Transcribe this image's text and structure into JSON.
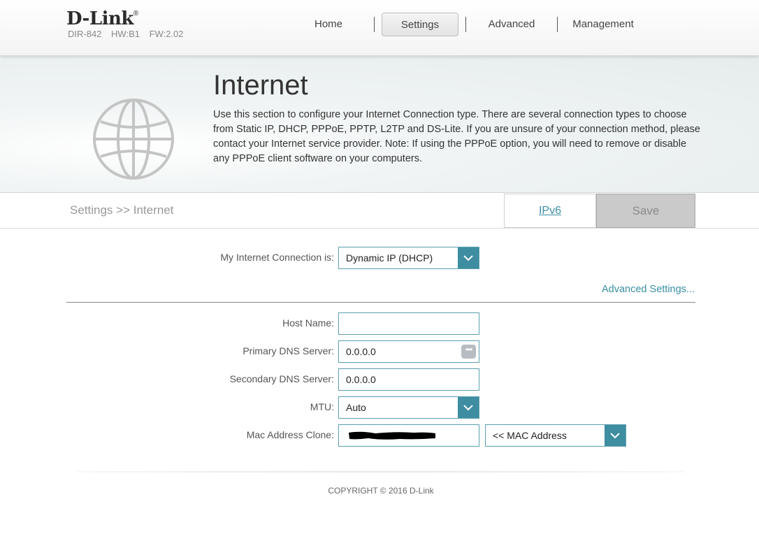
{
  "brand": {
    "logo": "D-Link",
    "reg": "®",
    "model": "DIR-842",
    "hw": "HW:B1",
    "fw": "FW:2.02"
  },
  "nav": {
    "home": "Home",
    "settings": "Settings",
    "advanced": "Advanced",
    "management": "Management",
    "active": "Settings"
  },
  "banner": {
    "title": "Internet",
    "description": "Use this section to configure your Internet Connection type. There are several connection types to choose from Static IP, DHCP, PPPoE, PPTP, L2TP and DS-Lite. If you are unsure of your connection method, please contact your Internet service provider. Note: If using the PPPoE option, you will need to remove or disable any PPPoE client software on your computers."
  },
  "breadcrumb": "Settings >> Internet",
  "toolbar": {
    "ipv6_label": "IPv6",
    "save_label": "Save"
  },
  "form": {
    "connection": {
      "label": "My Internet Connection is:",
      "value": "Dynamic IP (DHCP)"
    },
    "advanced_link": "Advanced Settings...",
    "host_name": {
      "label": "Host Name:",
      "value": ""
    },
    "primary_dns": {
      "label": "Primary DNS Server:",
      "value": "0.0.0.0"
    },
    "secondary_dns": {
      "label": "Secondary DNS Server:",
      "value": "0.0.0.0"
    },
    "mtu": {
      "label": "MTU:",
      "value": "Auto"
    },
    "mac_clone": {
      "label": "Mac Address Clone:",
      "value": "",
      "select_value": "<< MAC Address"
    }
  },
  "footer": {
    "copyright": "COPYRIGHT © 2016 D-Link"
  },
  "colors": {
    "accent": "#3e8da1",
    "link": "#3a8fa3",
    "border": "#5a9fae",
    "save_bg": "#cacaca"
  },
  "icons": {
    "banner": "globe-icon",
    "dropdown": "chevron-down-icon",
    "more": "ellipsis-icon"
  }
}
